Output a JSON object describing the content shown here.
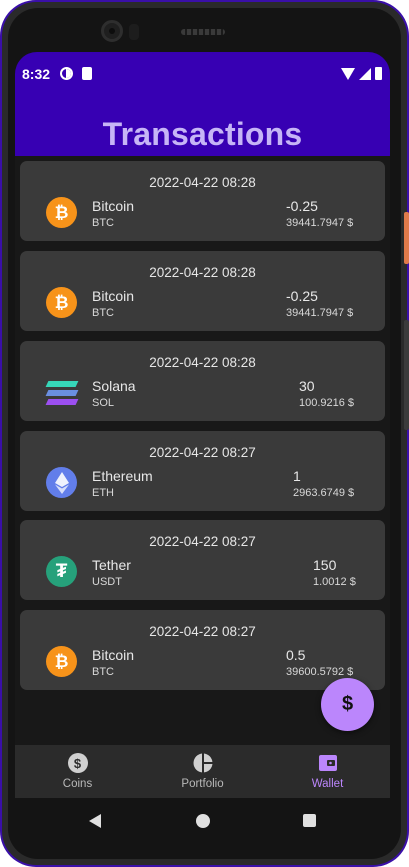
{
  "status_bar": {
    "time": "8:32"
  },
  "header": {
    "title": "Transactions"
  },
  "transactions": [
    {
      "date": "2022-04-22 08:28",
      "name": "Bitcoin",
      "symbol": "BTC",
      "amount": "-0.25",
      "price": "39441.7947 $",
      "icon": "bitcoin-icon",
      "icon_glyph": "₿",
      "color": "#f7931a"
    },
    {
      "date": "2022-04-22 08:28",
      "name": "Bitcoin",
      "symbol": "BTC",
      "amount": "-0.25",
      "price": "39441.7947 $",
      "icon": "bitcoin-icon",
      "icon_glyph": "₿",
      "color": "#f7931a"
    },
    {
      "date": "2022-04-22 08:28",
      "name": "Solana",
      "symbol": "SOL",
      "amount": "30",
      "price": "100.9216 $",
      "icon": "solana-icon",
      "icon_glyph": "",
      "color": "#9945ff"
    },
    {
      "date": "2022-04-22 08:27",
      "name": "Ethereum",
      "symbol": "ETH",
      "amount": "1",
      "price": "2963.6749 $",
      "icon": "ethereum-icon",
      "icon_glyph": "",
      "color": "#627eea"
    },
    {
      "date": "2022-04-22 08:27",
      "name": "Tether",
      "symbol": "USDT",
      "amount": "150",
      "price": "1.0012 $",
      "icon": "tether-icon",
      "icon_glyph": "₮",
      "color": "#26a17b"
    },
    {
      "date": "2022-04-22 08:27",
      "name": "Bitcoin",
      "symbol": "BTC",
      "amount": "0.5",
      "price": "39600.5792 $",
      "icon": "bitcoin-icon",
      "icon_glyph": "₿",
      "color": "#f7931a"
    }
  ],
  "fab": {
    "label": "$"
  },
  "bottom_nav": {
    "items": [
      {
        "label": "Coins",
        "icon": "dollar-coin-icon",
        "active": false
      },
      {
        "label": "Portfolio",
        "icon": "pie-chart-icon",
        "active": false
      },
      {
        "label": "Wallet",
        "icon": "wallet-icon",
        "active": true
      }
    ]
  },
  "colors": {
    "primary": "#3700b3",
    "accent": "#bb86fc",
    "title": "#c6b5f6",
    "card": "#3a3a3a",
    "background": "#181818"
  }
}
